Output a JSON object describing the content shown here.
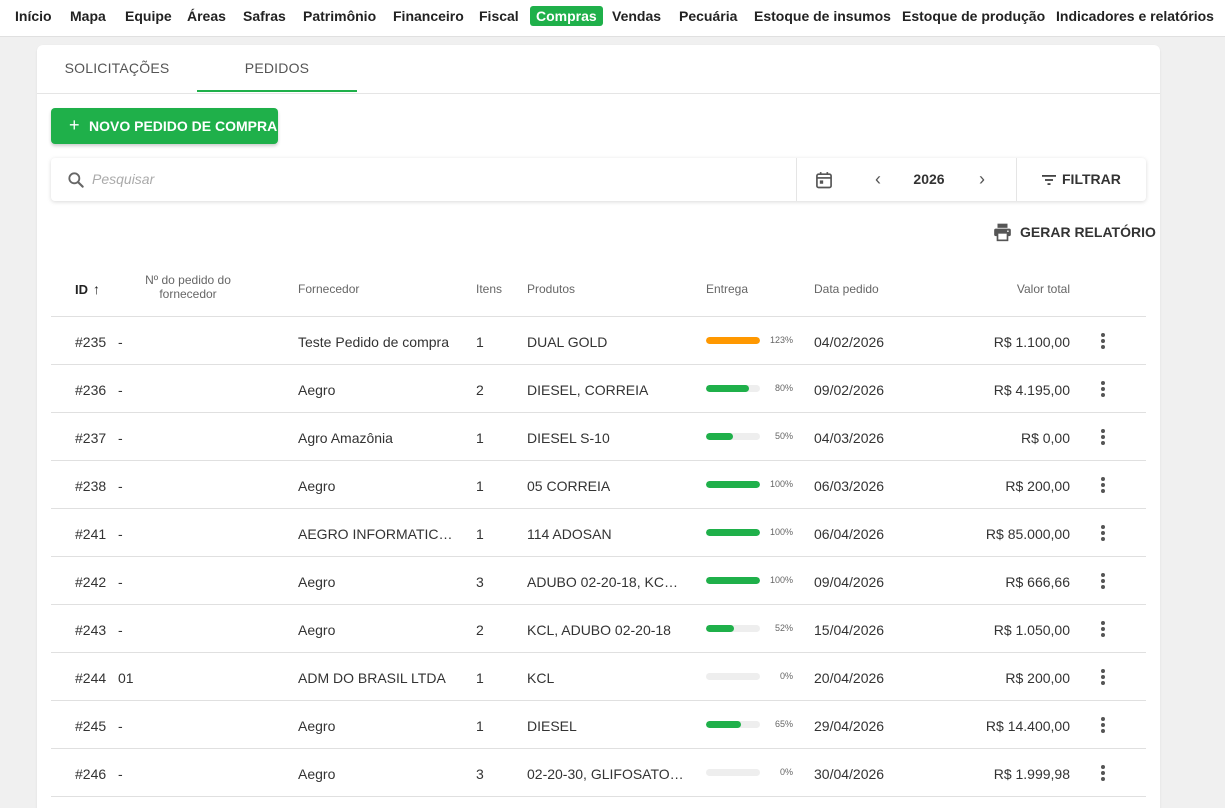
{
  "nav": {
    "items": [
      "Início",
      "Mapa",
      "Equipe",
      "Áreas",
      "Safras",
      "Patrimônio",
      "Financeiro",
      "Fiscal",
      "Compras",
      "Vendas",
      "Pecuária",
      "Estoque de insumos",
      "Estoque de produção",
      "Indicadores e relatórios"
    ],
    "active": "Compras"
  },
  "tabs": [
    "SOLICITAÇÕES",
    "PEDIDOS"
  ],
  "active_tab": "PEDIDOS",
  "new_button": {
    "icon": "+",
    "label": "NOVO PEDIDO DE COMPRA"
  },
  "search": {
    "placeholder": "Pesquisar"
  },
  "year": "2026",
  "filter_label": "FILTRAR",
  "report_label": "GERAR RELATÓRIO",
  "columns": {
    "id": "ID",
    "num": "Nº do pedido do fornecedor",
    "forn": "Fornecedor",
    "itens": "Itens",
    "prod": "Produtos",
    "entrega": "Entrega",
    "date": "Data pedido",
    "val": "Valor total"
  },
  "colors": {
    "accent": "#1fb04a",
    "overdue": "#ff9800",
    "track": "#eeeeee"
  },
  "rows": [
    {
      "id": "#235",
      "num": "-",
      "forn": "Teste Pedido de compra",
      "itens": "1",
      "prod": "DUAL GOLD",
      "pct": 123,
      "pct_label": "123%",
      "date": "04/02/2026",
      "val": "R$ 1.100,00"
    },
    {
      "id": "#236",
      "num": "-",
      "forn": "Aegro",
      "itens": "2",
      "prod": "DIESEL, CORREIA",
      "pct": 80,
      "pct_label": "80%",
      "date": "09/02/2026",
      "val": "R$ 4.195,00"
    },
    {
      "id": "#237",
      "num": "-",
      "forn": "Agro Amazônia",
      "itens": "1",
      "prod": "DIESEL S-10",
      "pct": 50,
      "pct_label": "50%",
      "date": "04/03/2026",
      "val": "R$ 0,00"
    },
    {
      "id": "#238",
      "num": "-",
      "forn": "Aegro",
      "itens": "1",
      "prod": "05 CORREIA",
      "pct": 100,
      "pct_label": "100%",
      "date": "06/03/2026",
      "val": "R$ 200,00"
    },
    {
      "id": "#241",
      "num": "-",
      "forn": "AEGRO INFORMATICA ...",
      "itens": "1",
      "prod": "114 ADOSAN",
      "pct": 100,
      "pct_label": "100%",
      "date": "06/04/2026",
      "val": "R$ 85.000,00"
    },
    {
      "id": "#242",
      "num": "-",
      "forn": "Aegro",
      "itens": "3",
      "prod": "ADUBO 02-20-18, KCL, ...",
      "pct": 100,
      "pct_label": "100%",
      "date": "09/04/2026",
      "val": "R$ 666,66"
    },
    {
      "id": "#243",
      "num": "-",
      "forn": "Aegro",
      "itens": "2",
      "prod": "KCL, ADUBO 02-20-18",
      "pct": 52,
      "pct_label": "52%",
      "date": "15/04/2026",
      "val": "R$ 1.050,00"
    },
    {
      "id": "#244",
      "num": "01",
      "forn": "ADM DO BRASIL LTDA",
      "itens": "1",
      "prod": "KCL",
      "pct": 0,
      "pct_label": "0%",
      "date": "20/04/2026",
      "val": "R$ 200,00"
    },
    {
      "id": "#245",
      "num": "-",
      "forn": "Aegro",
      "itens": "1",
      "prod": "DIESEL",
      "pct": 65,
      "pct_label": "65%",
      "date": "29/04/2026",
      "val": "R$ 14.400,00"
    },
    {
      "id": "#246",
      "num": "-",
      "forn": "Aegro",
      "itens": "3",
      "prod": "02-20-30, GLIFOSATO, C...",
      "pct": 0,
      "pct_label": "0%",
      "date": "30/04/2026",
      "val": "R$ 1.999,98"
    }
  ]
}
